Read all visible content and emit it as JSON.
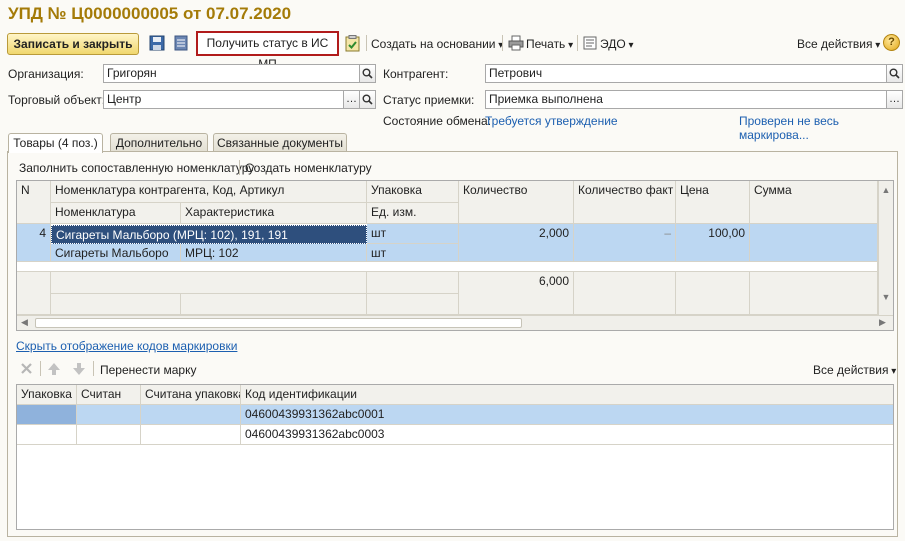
{
  "window": {
    "title": "УПД № Ц0000000005 от 07.07.2020"
  },
  "toolbar": {
    "save_close": "Записать и закрыть",
    "get_status": "Получить статус в ИС МП",
    "create_based": "Создать на основании",
    "print": "Печать",
    "edo": "ЭДО",
    "all_actions": "Все действия",
    "help": "?"
  },
  "form": {
    "org_label": "Организация:",
    "org_value": "Григорян",
    "contractor_label": "Контрагент:",
    "contractor_value": "Петрович",
    "trade_label": "Торговый объект:",
    "trade_value": "Центр",
    "accept_label": "Статус приемки:",
    "accept_value": "Приемка выполнена",
    "exchange_label": "Состояние обмена:",
    "exchange_value": "Требуется утверждение",
    "marking_link": "Проверен не весь маркирова..."
  },
  "tabs": [
    {
      "label": "Товары (4 поз.)"
    },
    {
      "label": "Дополнительно"
    },
    {
      "label": "Связанные документы"
    }
  ],
  "goods": {
    "fill_cmd": "Заполнить сопоставленную номенклатуру",
    "create_cmd": "Создать номенклатуру",
    "headers": {
      "n": "N",
      "nom_contr": "Номенклатура контрагента, Код, Артикул",
      "pack": "Упаковка",
      "qty": "Количество",
      "qty_fact": "Количество факт",
      "price": "Цена",
      "sum": "Сумма",
      "nom": "Номенклатура",
      "char": "Характеристика",
      "unit": "Ед. изм."
    },
    "row": {
      "n": "4",
      "nom_contr": "Сигареты Мальборо (МРЦ: 102), 191, 191",
      "pack": "шт",
      "qty": "2,000",
      "qty_fact": "–",
      "price": "100,00",
      "sum": "",
      "nom": "Сигареты Мальборо",
      "char": "МРЦ: 102",
      "unit": "шт"
    },
    "total_qty": "6,000"
  },
  "codes": {
    "hide_link": "Скрыть отображение кодов маркировки",
    "move_mark": "Перенести марку",
    "all_actions": "Все действия",
    "headers": {
      "pack": "Упаковка",
      "scanned": "Считан",
      "scanned_pack": "Считана упаковка",
      "code": "Код идентификации"
    },
    "rows": [
      {
        "code": "04600439931362abc0001"
      },
      {
        "code": "04600439931362abc0003"
      }
    ]
  }
}
